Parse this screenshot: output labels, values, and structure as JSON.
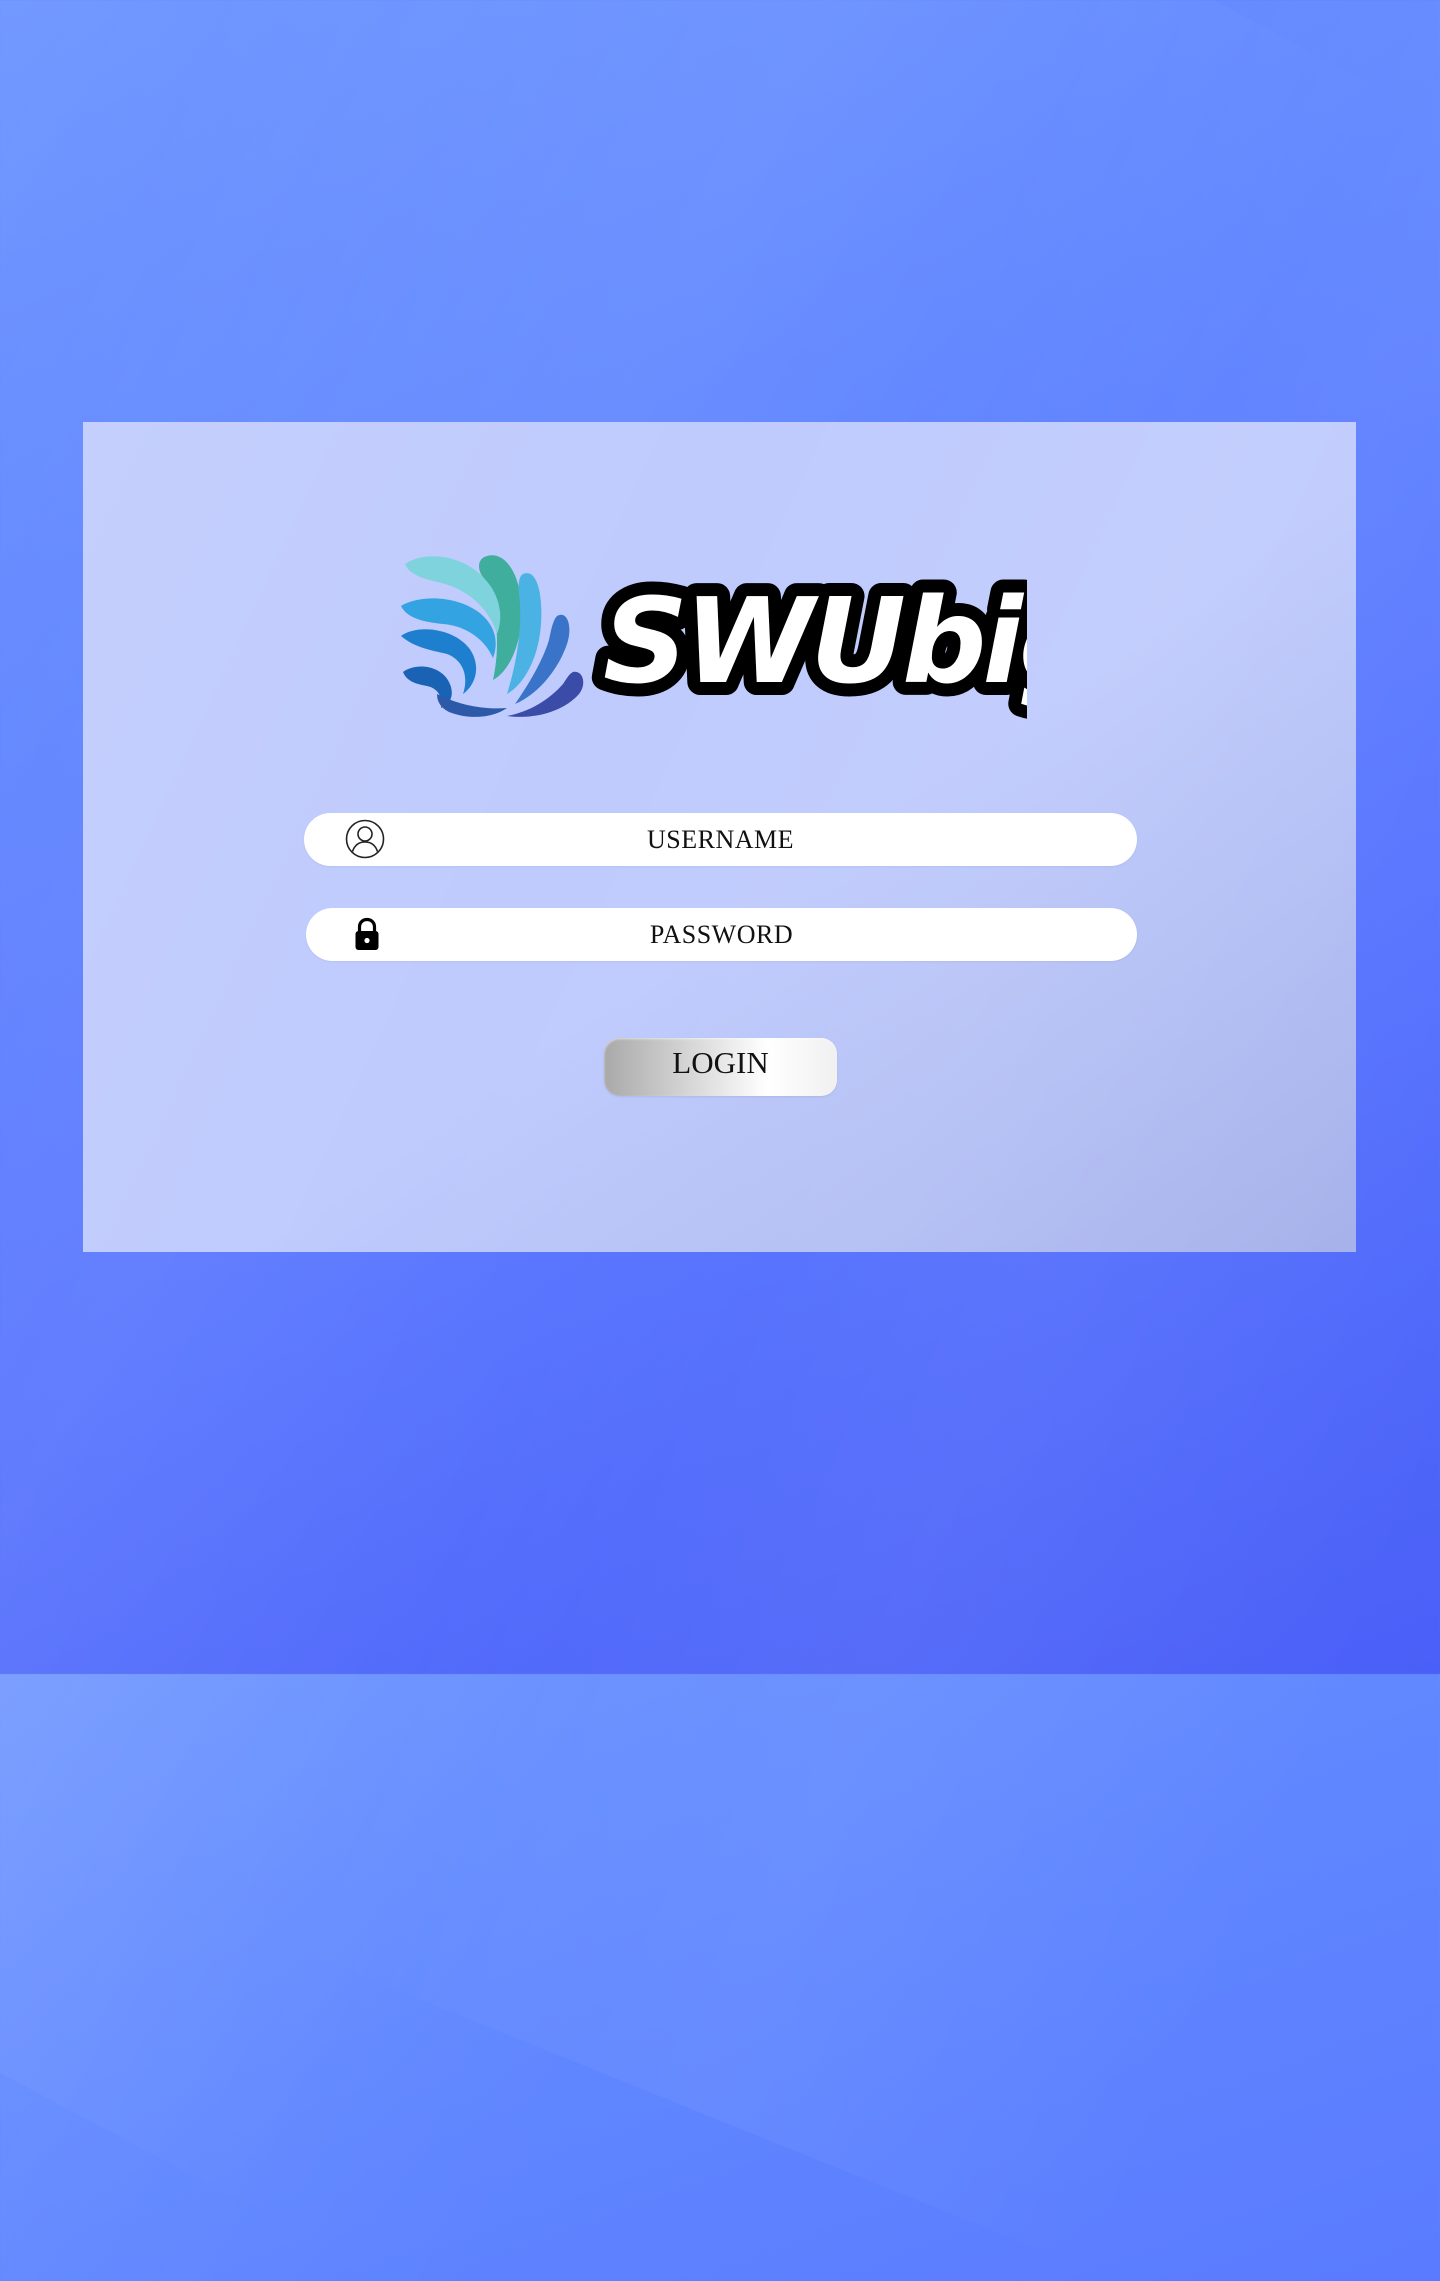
{
  "app": {
    "logo_text": "SWUbig"
  },
  "login": {
    "username_placeholder": "USERNAME",
    "password_placeholder": "PASSWORD",
    "submit_label": "LOGIN"
  },
  "icons": {
    "username": "user-circle-icon",
    "password": "lock-icon"
  },
  "colors": {
    "background_top": "#6a93ff",
    "background_bottom": "#4a5ff7",
    "card": "#bfcbfd",
    "field": "#ffffff"
  }
}
